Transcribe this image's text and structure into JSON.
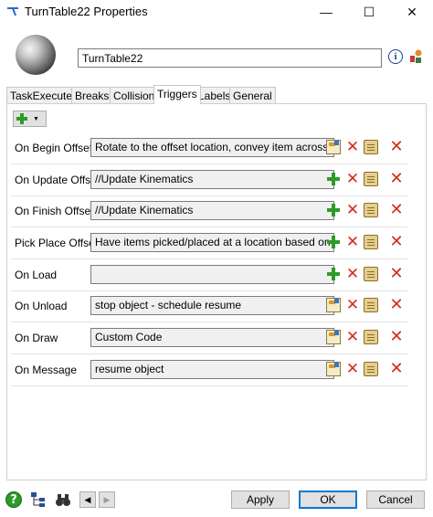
{
  "window": {
    "title": "TurnTable22  Properties",
    "controls": {
      "minimize": "—",
      "maximize": "☐",
      "close": "✕"
    }
  },
  "object": {
    "name": "TurnTable22",
    "info_glyph": "i"
  },
  "tabs": [
    {
      "label": "TaskExecuter"
    },
    {
      "label": "Breaks"
    },
    {
      "label": "Collision"
    },
    {
      "label": "Triggers",
      "active": true
    },
    {
      "label": "Labels"
    },
    {
      "label": "General"
    }
  ],
  "add_button": {
    "caret": "▼"
  },
  "triggers": [
    {
      "label": "On Begin Offset",
      "value": "Rotate to the offset location, convey item across turntable",
      "edit_icon": "properties-icon"
    },
    {
      "label": "On Update Offset",
      "value": "//Update Kinematics",
      "edit_icon": "add-icon"
    },
    {
      "label": "On Finish Offset",
      "value": "//Update Kinematics",
      "edit_icon": "add-icon"
    },
    {
      "label": "Pick Place Offset",
      "value": "Have items picked/placed at a location based on percentage",
      "edit_icon": "add-icon"
    },
    {
      "label": "On Load",
      "value": "",
      "edit_icon": "add-icon"
    },
    {
      "label": "On Unload",
      "value": "stop object - schedule resume",
      "edit_icon": "properties-icon"
    },
    {
      "label": "On Draw",
      "value": "Custom Code",
      "edit_icon": "properties-icon"
    },
    {
      "label": "On Message",
      "value": "resume object",
      "edit_icon": "properties-icon"
    }
  ],
  "row_icons": {
    "delete_glyph": "✕",
    "remove_glyph": "✕"
  },
  "footer": {
    "help_glyph": "?",
    "prev_glyph": "◀",
    "next_glyph": "▶",
    "apply": "Apply",
    "ok": "OK",
    "cancel": "Cancel"
  },
  "colors": {
    "accent_blue": "#0078d7",
    "delete_red": "#d42a1a",
    "add_green": "#2e9a2a"
  }
}
